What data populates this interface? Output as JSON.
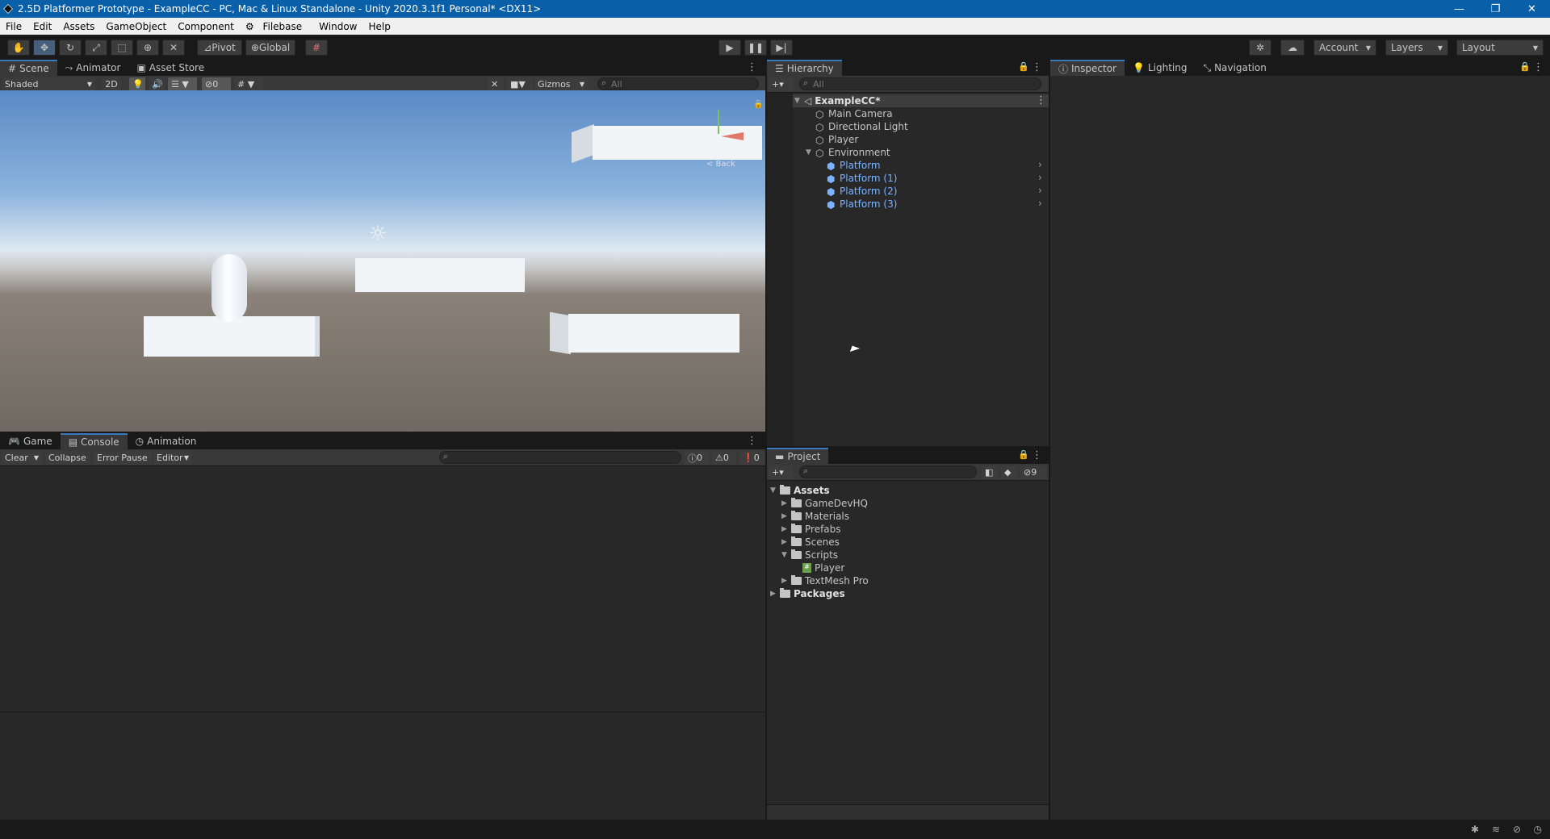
{
  "window": {
    "title": "2.5D Platformer Prototype - ExampleCC - PC, Mac & Linux Standalone - Unity 2020.3.1f1 Personal* <DX11>",
    "controls": [
      "—",
      "❐",
      "✕"
    ]
  },
  "menu": [
    "File",
    "Edit",
    "Assets",
    "GameObject",
    "Component",
    "Filebase",
    "Window",
    "Help"
  ],
  "toolbar": {
    "pivot": "Pivot",
    "global": "Global",
    "account": "Account",
    "layers": "Layers",
    "layout": "Layout"
  },
  "scene": {
    "tabs": [
      "Scene",
      "Animator",
      "Asset Store"
    ],
    "shading": "Shaded",
    "mode_2d": "2D",
    "hidden_count": "0",
    "gizmos": "Gizmos",
    "search_placeholder": "All",
    "gizmo_label": "< Back"
  },
  "console": {
    "tabs": [
      "Game",
      "Console",
      "Animation"
    ],
    "clear": "Clear",
    "collapse": "Collapse",
    "error_pause": "Error Pause",
    "editor": "Editor",
    "log_count": "0",
    "warn_count": "0",
    "error_count": "0"
  },
  "hierarchy": {
    "title": "Hierarchy",
    "search_placeholder": "All",
    "scene_name": "ExampleCC*",
    "items": [
      "Main Camera",
      "Directional Light",
      "Player",
      "Environment"
    ],
    "children": [
      "Platform",
      "Platform (1)",
      "Platform (2)",
      "Platform (3)"
    ]
  },
  "inspector": {
    "tabs": [
      "Inspector",
      "Lighting",
      "Navigation"
    ]
  },
  "project": {
    "title": "Project",
    "hidden_count": "9",
    "assets_label": "Assets",
    "folders": [
      "GameDevHQ",
      "Materials",
      "Prefabs",
      "Scenes",
      "Scripts"
    ],
    "script_file": "Player",
    "textmesh": "TextMesh Pro",
    "packages": "Packages"
  },
  "colors": {
    "title_bar": "#0a60a8",
    "accent_tab": "#3a79bb",
    "prefab_blue": "#7cb3ff",
    "panel_bg": "#282828"
  }
}
